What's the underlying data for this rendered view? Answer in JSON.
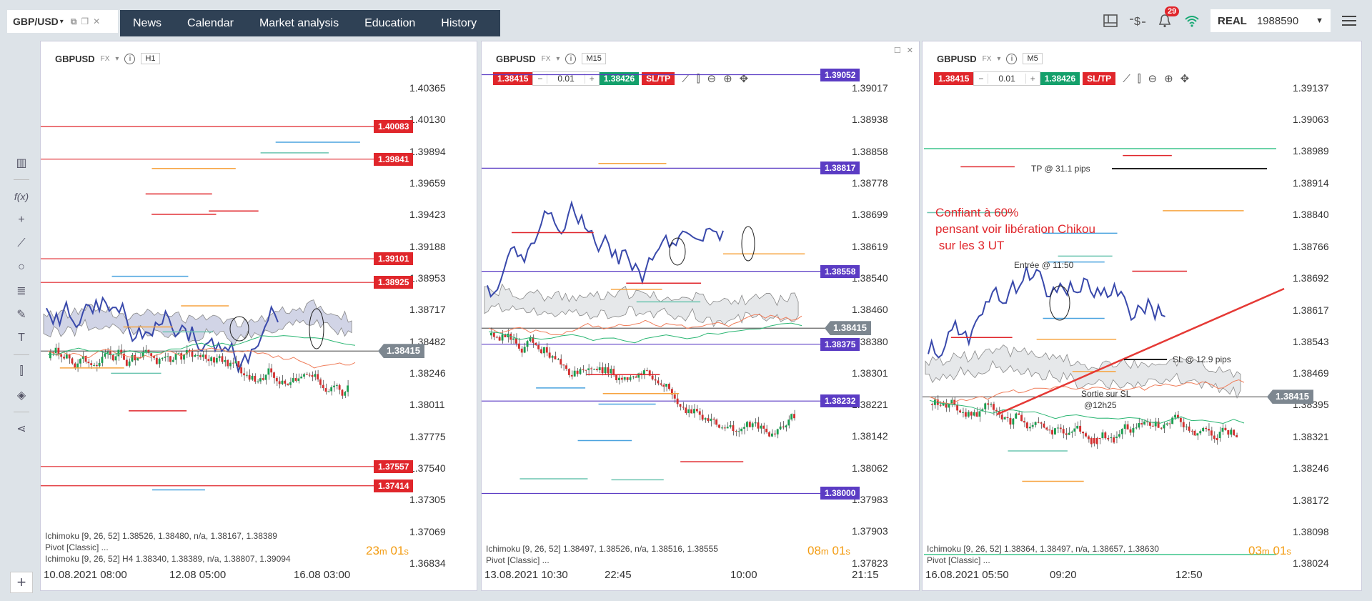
{
  "symbol_tab": {
    "label": "GBP/USD",
    "caret": "▾"
  },
  "nav": {
    "items": [
      "News",
      "Calendar",
      "Market analysis",
      "Education",
      "History"
    ]
  },
  "notifications": {
    "count": "29"
  },
  "account": {
    "type": "REAL",
    "number": "1988590"
  },
  "colors": {
    "nav_bg": "#2f4155",
    "sell": "#e0262b",
    "buy": "#14a06b",
    "level_red": "#e0262b",
    "level_purple": "#5b3cc4",
    "countdown": "#f39c12"
  },
  "panels": [
    {
      "symbol": "GBPUSD",
      "type": "FX",
      "timeframe": "H1",
      "y_labels": [
        "1.40365",
        "1.40130",
        "1.39894",
        "1.39659",
        "1.39423",
        "1.39188",
        "1.38953",
        "1.38717",
        "1.38482",
        "1.38246",
        "1.38011",
        "1.37775",
        "1.37540",
        "1.37305",
        "1.37069",
        "1.36834"
      ],
      "price_tags": [
        "1.40083",
        "1.39841",
        "1.39101",
        "1.38925",
        "1.37557",
        "1.37414"
      ],
      "current_price": "1.38415",
      "legend": [
        "Ichimoku [9, 26, 52] 1.38526, 1.38480, n/a, 1.38167, 1.38389",
        "Pivot [Classic] ...",
        "Ichimoku [9, 26, 52] H4 1.38340, 1.38389, n/a, 1.38807, 1.39094"
      ],
      "countdown": {
        "min": "23",
        "m": "m",
        "sec": "01",
        "s": "s"
      },
      "x_labels": [
        "10.08.2021 08:00",
        "12.08 05:00",
        "16.08 03:00"
      ]
    },
    {
      "symbol": "GBPUSD",
      "type": "FX",
      "timeframe": "M15",
      "order": {
        "sell": "1.38415",
        "minus": "−",
        "qty": "0.01",
        "plus": "+",
        "buy": "1.38426",
        "sltp": "SL/TP"
      },
      "y_labels": [
        "1.39017",
        "1.38938",
        "1.38858",
        "1.38778",
        "1.38699",
        "1.38619",
        "1.38540",
        "1.38460",
        "1.38380",
        "1.38301",
        "1.38221",
        "1.38142",
        "1.38062",
        "1.37983",
        "1.37903",
        "1.37823"
      ],
      "price_tags": [
        "1.39052",
        "1.38817",
        "1.38558",
        "1.38375",
        "1.38232",
        "1.38000"
      ],
      "current_price": "1.38415",
      "legend": [
        "Ichimoku [9, 26, 52] 1.38497, 1.38526, n/a, 1.38516, 1.38555",
        "Pivot [Classic] ..."
      ],
      "countdown": {
        "min": "08",
        "m": "m",
        "sec": "01",
        "s": "s"
      },
      "x_labels": [
        "13.08.2021 10:30",
        "22:45",
        "10:00",
        "21:15"
      ]
    },
    {
      "symbol": "GBPUSD",
      "type": "FX",
      "timeframe": "M5",
      "order": {
        "sell": "1.38415",
        "minus": "−",
        "qty": "0.01",
        "plus": "+",
        "buy": "1.38426",
        "sltp": "SL/TP"
      },
      "y_labels": [
        "1.39137",
        "1.39063",
        "1.38989",
        "1.38914",
        "1.38840",
        "1.38766",
        "1.38692",
        "1.38617",
        "1.38543",
        "1.38469",
        "1.38395",
        "1.38321",
        "1.38246",
        "1.38172",
        "1.38098",
        "1.38024"
      ],
      "current_price": "1.38415",
      "annotations": {
        "note": "Confiant à 60%\npensant voir libération Chikou\n sur les 3 UT",
        "tp": "TP @ 31.1 pips",
        "entry": "Entrée @ 11:50",
        "sl": "SL @ 12.9 pips",
        "exit1": "Sortie sur SL",
        "exit2": "@12h25"
      },
      "legend": [
        "Ichimoku [9, 26, 52] 1.38364, 1.38497, n/a, 1.38657, 1.38630",
        "Pivot [Classic] ..."
      ],
      "countdown": {
        "min": "03",
        "m": "m",
        "sec": "01",
        "s": "s"
      },
      "x_labels": [
        "16.08.2021 05:50",
        "09:20",
        "12:50"
      ]
    }
  ]
}
